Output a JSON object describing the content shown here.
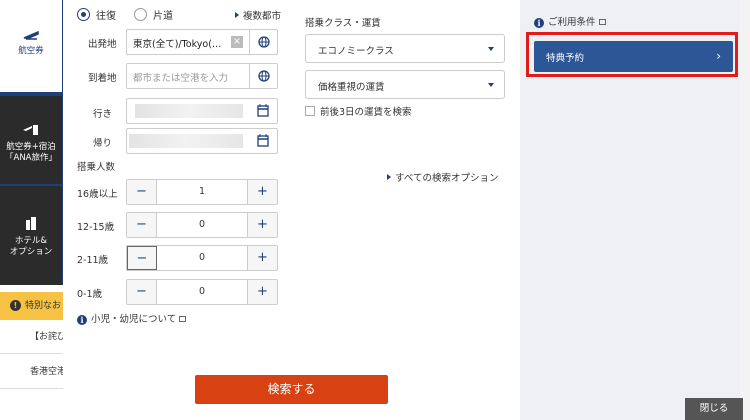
{
  "nav": {
    "items": [
      {
        "label": "航空券",
        "icon": "plane-icon"
      },
      {
        "label_1": "航空券+宿泊",
        "label_2": "「ANA旅作」",
        "icon": "plane-hotel-icon"
      },
      {
        "label_1": "ホテル&",
        "label_2": "オプション",
        "icon": "building-icon"
      }
    ]
  },
  "background": {
    "notice": "特別なお",
    "row1": "【お詫び",
    "row2": "香港空港"
  },
  "trip": {
    "round": "往復",
    "oneway": "片道",
    "multi": "複数都市"
  },
  "route": {
    "from_label": "出発地",
    "from_value": "東京(全て)/Tokyo(…",
    "clear": "×",
    "to_label": "到着地",
    "to_placeholder": "都市または空港を入力",
    "depart_label": "行き",
    "return_label": "帰り"
  },
  "passengers": {
    "title": "搭乗人数",
    "rows": [
      {
        "label": "16歳以上",
        "count": "1"
      },
      {
        "label": "12-15歳",
        "count": "0"
      },
      {
        "label": "2-11歳",
        "count": "0"
      },
      {
        "label": "0-1歳",
        "count": "0"
      }
    ],
    "minus": "−",
    "plus": "+",
    "child_info": "小児・幼児について"
  },
  "class": {
    "title": "搭乗クラス・運賃",
    "cabin": "エコノミークラス",
    "fare": "価格重視の運賃",
    "flex_dates": "前後3日の運賃を検索",
    "all_options": "すべての検索オプション"
  },
  "actions": {
    "search": "検索する",
    "close": "閉じる"
  },
  "side": {
    "conditions": "ご利用条件",
    "award": "特典予約",
    "award_chevron": "›"
  },
  "colors": {
    "brand_blue": "#1f3f7a",
    "award_blue": "#2d5697",
    "search_orange": "#d84112",
    "highlight_red": "#e21b1b"
  }
}
